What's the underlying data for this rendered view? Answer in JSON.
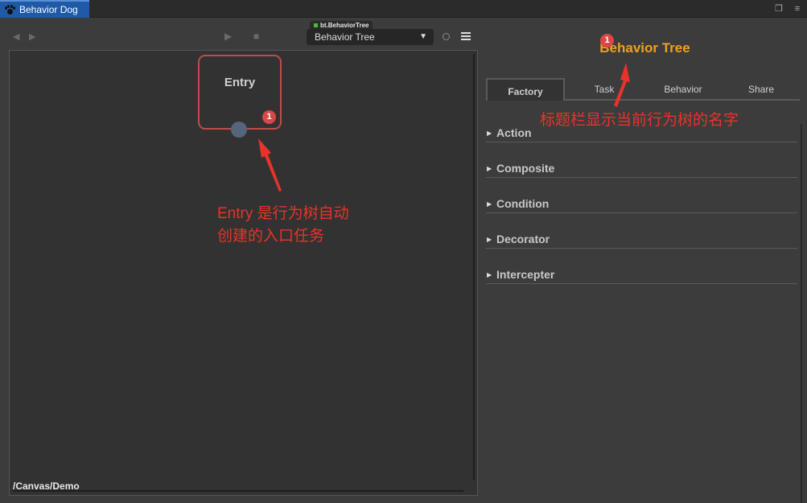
{
  "window": {
    "tab_title": "Behavior Dog"
  },
  "toolbar": {
    "tree_label": "bt.BehaviorTree",
    "tree_selected": "Behavior Tree"
  },
  "canvas": {
    "entry_node": {
      "title": "Entry",
      "badge": "1"
    },
    "path": "/Canvas/Demo"
  },
  "annotations": {
    "entry_note_line1": "Entry 是行为树自动",
    "entry_note_line2": "创建的入口任务",
    "title_note": "标题栏显示当前行为树的名字"
  },
  "right_panel": {
    "title": "Behavior Tree",
    "title_badge": "1",
    "tabs": [
      "Factory",
      "Task",
      "Behavior",
      "Share"
    ],
    "active_tab": "Factory",
    "categories": [
      "Action",
      "Composite",
      "Condition",
      "Decorator",
      "Intercepter"
    ]
  },
  "colors": {
    "accent_orange": "#f0a020",
    "node_border": "#c44a4a",
    "annotation_red": "#e8332a",
    "tab_blue": "#1f5aa8"
  }
}
